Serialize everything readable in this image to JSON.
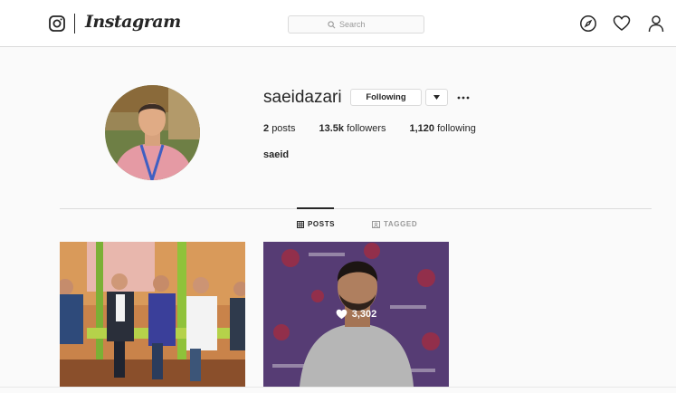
{
  "header": {
    "logo_text": "Instagram",
    "search_placeholder": "Search",
    "icons": [
      "instagram-camera-icon",
      "search-icon",
      "explore-compass-icon",
      "activity-heart-icon",
      "profile-person-icon"
    ]
  },
  "profile": {
    "username": "saeidazari",
    "follow_button_label": "Following",
    "posts_count": "2",
    "posts_label": "posts",
    "followers_count": "13.5k",
    "followers_label": "followers",
    "following_count": "1,120",
    "following_label": "following",
    "full_name": "saeid"
  },
  "tabs": [
    {
      "label": "POSTS",
      "active": true,
      "icon": "grid-icon"
    },
    {
      "label": "TAGGED",
      "active": false,
      "icon": "tagged-icon"
    }
  ],
  "posts": [
    {
      "likes": null,
      "has_overlay": false
    },
    {
      "likes": "3,302",
      "has_overlay": true
    }
  ],
  "colors": {
    "border": "#dbdbdb",
    "text": "#262626",
    "muted": "#999999",
    "background": "#fafafa"
  }
}
